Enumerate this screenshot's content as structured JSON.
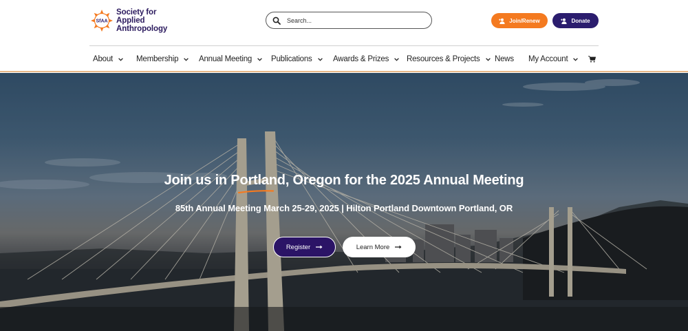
{
  "brand": {
    "logo_mark_text": "SfAA",
    "name_line1": "Society for",
    "name_line2": "Applied",
    "name_line3": "Anthropology"
  },
  "search": {
    "placeholder": "Search..."
  },
  "header_buttons": {
    "join_label": "Join/Renew",
    "donate_label": "Donate"
  },
  "nav": {
    "items": [
      {
        "label": "About",
        "has_dropdown": true
      },
      {
        "label": "Membership",
        "has_dropdown": true
      },
      {
        "label": "Annual Meeting",
        "has_dropdown": true
      },
      {
        "label": "Publications",
        "has_dropdown": true
      },
      {
        "label": "Awards & Prizes",
        "has_dropdown": true
      },
      {
        "label": "Resources & Projects",
        "has_dropdown": true
      },
      {
        "label": "News",
        "has_dropdown": false
      },
      {
        "label": "My Account",
        "has_dropdown": true
      }
    ],
    "cart_icon": "shopping-cart-icon"
  },
  "hero": {
    "title": "Join us in Portland, Oregon for the 2025 Annual Meeting",
    "subtitle": "85th Annual Meeting March 25-29, 2025 | Hilton Portland Downtown Portland, OR",
    "register_label": "Register",
    "learn_more_label": "Learn More"
  },
  "colors": {
    "brand_purple": "#2b1d6e",
    "brand_orange": "#f47a20",
    "register_purple": "#2b1466"
  }
}
